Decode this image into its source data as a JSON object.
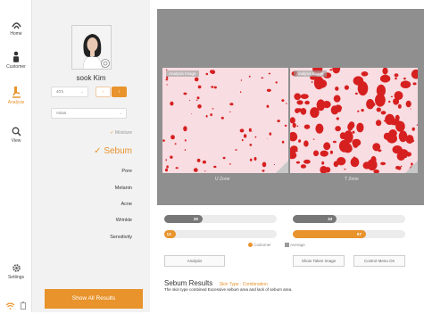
{
  "nav": {
    "items": [
      {
        "label": "Home",
        "icon": "home-icon"
      },
      {
        "label": "Customer",
        "icon": "customer-icon"
      },
      {
        "label": "Analysis",
        "icon": "analysis-icon"
      },
      {
        "label": "View",
        "icon": "view-icon"
      },
      {
        "label": "Settings",
        "icon": "settings-icon"
      }
    ],
    "status_icons": [
      "wifi-icon",
      "battery-icon"
    ]
  },
  "profile": {
    "name": "sook Kim",
    "age_group": "40's",
    "ethnicity": "Asian",
    "gender_options": [
      "male-icon",
      "female-icon"
    ],
    "selected_gender": "female"
  },
  "menu": {
    "moisture": "Moisture",
    "sebum": "Sebum",
    "pore": "Pore",
    "melanin": "Melanin",
    "acne": "Acne",
    "wrinkle": "Wrinkle",
    "sensitivity": "Sensitivity",
    "selected": "Sebum"
  },
  "show_all_label": "Show All Results",
  "analysis_panel": {
    "left_tag": "Analysis Image",
    "right_tag": "Analysis Image",
    "left_caption": "U Zone",
    "right_caption": "T Zone"
  },
  "meters": {
    "average_u": {
      "value": "29",
      "fraction": 0.34
    },
    "average_t": {
      "value": "33",
      "fraction": 0.39
    },
    "customer_u": {
      "value": "13",
      "fraction": 0.1
    },
    "customer_t": {
      "value": "57",
      "fraction": 0.65
    }
  },
  "legend": {
    "customer": "Customer",
    "average": "Average"
  },
  "buttons": {
    "analysis": "Analysis",
    "show_taken_image": "Show Taken Image",
    "control_menu": "Control Menu On"
  },
  "results": {
    "title": "Sebum Results",
    "skin_type": "Skin Type : Combination",
    "description": "The skin type combined Excessive sebum area and lack of sebum area."
  },
  "colors": {
    "accent": "#e8932c",
    "average": "#777777",
    "sebum_spot": "#d62020"
  }
}
